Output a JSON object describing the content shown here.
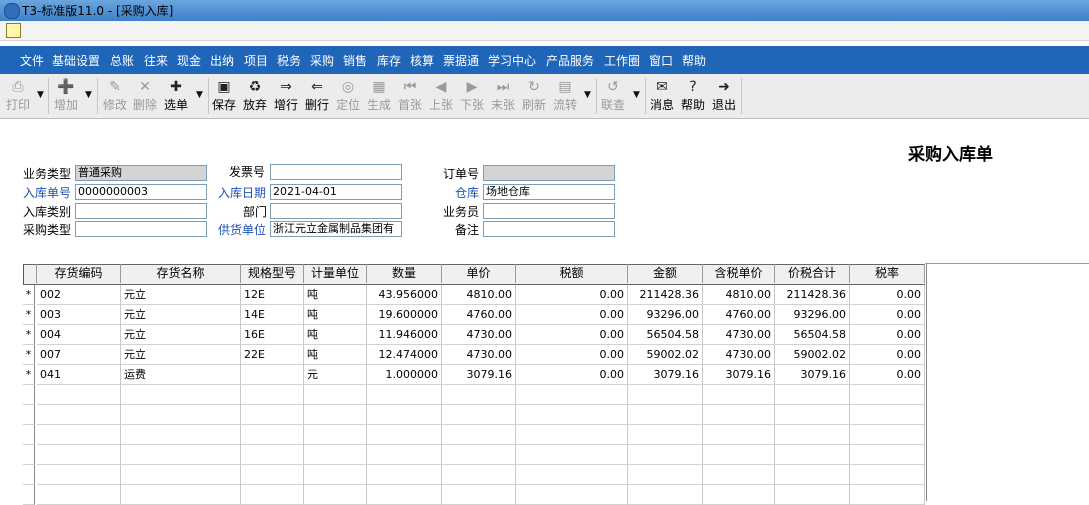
{
  "window": {
    "title": "T3-标准版11.0 - [采购入库]"
  },
  "menu": [
    "文件",
    "基础设置",
    "总账",
    "往来",
    "现金",
    "出纳",
    "项目",
    "税务",
    "采购",
    "销售",
    "库存",
    "核算",
    "票据通",
    "学习中心",
    "产品服务",
    "工作圈",
    "窗口",
    "帮助"
  ],
  "toolbar": {
    "print": "打印",
    "add": "增加",
    "modify": "修改",
    "delete": "删除",
    "select": "选单",
    "save": "保存",
    "abandon": "放弃",
    "add_row": "增行",
    "delete_row": "删行",
    "locate": "定位",
    "generate": "生成",
    "first": "首张",
    "prev": "上张",
    "next": "下张",
    "last": "末张",
    "refresh": "刷新",
    "flow": "流转",
    "query": "联查",
    "message": "消息",
    "help": "帮助",
    "exit": "退出"
  },
  "form": {
    "title": "采购入库单",
    "business_type_label": "业务类型",
    "business_type": "普通采购",
    "invoice_no_label": "发票号",
    "invoice_no": "",
    "order_no_label": "订单号",
    "order_no": "",
    "receipt_no_label": "入库单号",
    "receipt_no": "0000000003",
    "receipt_date_label": "入库日期",
    "receipt_date": "2021-04-01",
    "warehouse_label": "仓库",
    "warehouse": "场地仓库",
    "receipt_category_label": "入库类别",
    "receipt_category": "",
    "department_label": "部门",
    "department": "",
    "salesperson_label": "业务员",
    "salesperson": "",
    "purchase_type_label": "采购类型",
    "purchase_type": "",
    "supplier_label": "供货单位",
    "supplier": "浙江元立金属制品集团有",
    "remark_label": "备注",
    "remark": ""
  },
  "grid": {
    "headers": [
      "存货编码",
      "存货名称",
      "规格型号",
      "计量单位",
      "数量",
      "单价",
      "税额",
      "金额",
      "含税单价",
      "价税合计",
      "税率"
    ],
    "rows": [
      {
        "mark": "*",
        "code": "002",
        "name": "元立",
        "spec": "12E",
        "unit": "吨",
        "qty": "43.956000",
        "price": "4810.00",
        "tax": "0.00",
        "amount": "211428.36",
        "tax_price": "4810.00",
        "total": "211428.36",
        "rate": "0.00"
      },
      {
        "mark": "*",
        "code": "003",
        "name": "元立",
        "spec": "14E",
        "unit": "吨",
        "qty": "19.600000",
        "price": "4760.00",
        "tax": "0.00",
        "amount": "93296.00",
        "tax_price": "4760.00",
        "total": "93296.00",
        "rate": "0.00"
      },
      {
        "mark": "*",
        "code": "004",
        "name": "元立",
        "spec": "16E",
        "unit": "吨",
        "qty": "11.946000",
        "price": "4730.00",
        "tax": "0.00",
        "amount": "56504.58",
        "tax_price": "4730.00",
        "total": "56504.58",
        "rate": "0.00"
      },
      {
        "mark": "*",
        "code": "007",
        "name": "元立",
        "spec": "22E",
        "unit": "吨",
        "qty": "12.474000",
        "price": "4730.00",
        "tax": "0.00",
        "amount": "59002.02",
        "tax_price": "4730.00",
        "total": "59002.02",
        "rate": "0.00"
      },
      {
        "mark": "*",
        "code": "041",
        "name": "运费",
        "spec": "",
        "unit": "元",
        "qty": "1.000000",
        "price": "3079.16",
        "tax": "0.00",
        "amount": "3079.16",
        "tax_price": "3079.16",
        "total": "3079.16",
        "rate": "0.00"
      }
    ]
  }
}
